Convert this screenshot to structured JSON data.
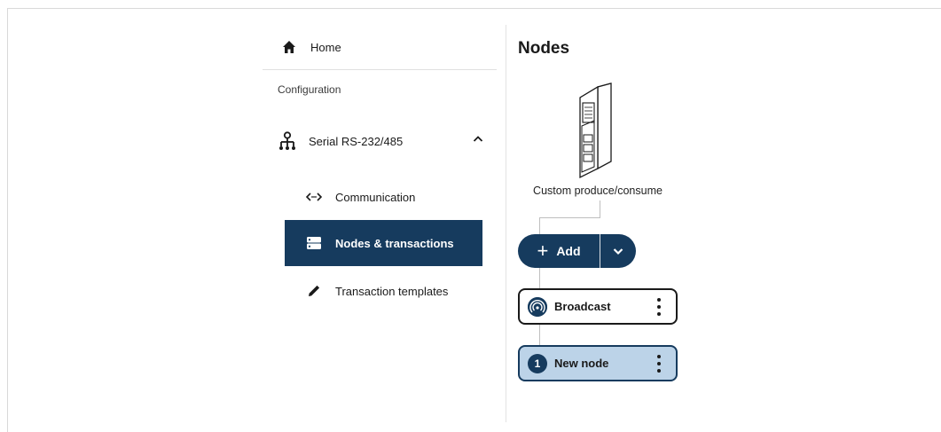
{
  "sidebar": {
    "home_label": "Home",
    "section_label": "Configuration",
    "serial_label": "Serial RS-232/485",
    "items": [
      {
        "label": "Communication",
        "icon": "code-brackets-icon",
        "active": false
      },
      {
        "label": "Nodes & transactions",
        "icon": "server-icon",
        "active": true
      },
      {
        "label": "Transaction templates",
        "icon": "pencil-icon",
        "active": false
      }
    ]
  },
  "main": {
    "title": "Nodes",
    "device_label": "Custom produce/consume",
    "add_label": "Add",
    "nodes": [
      {
        "label": "Broadcast",
        "icon": "broadcast-icon"
      },
      {
        "label": "New node",
        "badge": "1"
      }
    ]
  },
  "colors": {
    "accent": "#163b5e",
    "selected_node_bg": "#bcd3e8",
    "text": "#1a1a1a"
  }
}
